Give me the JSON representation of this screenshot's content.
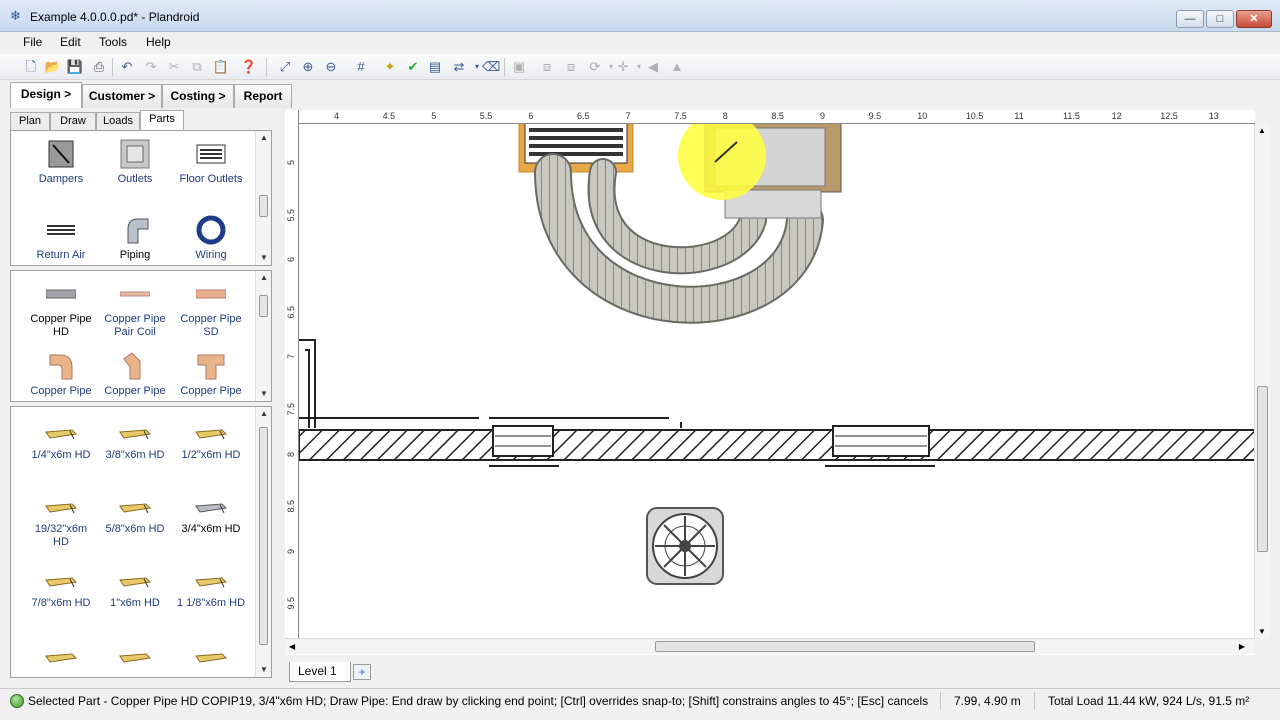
{
  "window": {
    "title": "Example 4.0.0.0.pd* - Plandroid",
    "min": "—",
    "max": "□",
    "close": "✕"
  },
  "menu": [
    "File",
    "Edit",
    "Tools",
    "Help"
  ],
  "nav_tabs": [
    "Design >",
    "Customer >",
    "Costing >",
    "Report"
  ],
  "sub_tabs": [
    "Plan",
    "Draw",
    "Loads",
    "Parts"
  ],
  "categories": [
    {
      "label": "Dampers"
    },
    {
      "label": "Outlets"
    },
    {
      "label": "Floor Outlets"
    },
    {
      "label": "Return Air"
    },
    {
      "label": "Piping"
    },
    {
      "label": "Wiring"
    }
  ],
  "pipe_types": [
    {
      "label": "Copper Pipe\nHD"
    },
    {
      "label": "Copper Pipe\nPair Coil"
    },
    {
      "label": "Copper Pipe\nSD"
    },
    {
      "label": "Copper Pipe"
    },
    {
      "label": "Copper Pipe"
    },
    {
      "label": "Copper Pipe"
    }
  ],
  "pipe_sizes": [
    {
      "label": "1/4\"x6m HD"
    },
    {
      "label": "3/8\"x6m HD"
    },
    {
      "label": "1/2\"x6m HD"
    },
    {
      "label": "19/32\"x6m\nHD"
    },
    {
      "label": "5/8\"x6m HD"
    },
    {
      "label": "3/4\"x6m HD"
    },
    {
      "label": "7/8\"x6m HD"
    },
    {
      "label": "1\"x6m HD"
    },
    {
      "label": "1 1/8\"x6m HD"
    }
  ],
  "ruler": {
    "unit": "m",
    "h_ticks": [
      "4",
      "4.5",
      "5",
      "5.5",
      "6",
      "6.5",
      "7",
      "7.5",
      "8",
      "8.5",
      "9",
      "9.5",
      "10",
      "10.5",
      "11",
      "11.5",
      "12",
      "12.5",
      "13"
    ],
    "v_ticks": [
      "5",
      "5.5",
      "6",
      "6.5",
      "7",
      "7.5",
      "8",
      "8.5",
      "9",
      "9.5"
    ]
  },
  "level_tab": "Level 1",
  "level_add": "+",
  "status": {
    "message": "Selected Part - Copper Pipe HD COPIP19, 3/4\"x6m HD; Draw Pipe: End draw by clicking end point; [Ctrl] overrides snap-to; [Shift] constrains angles to 45°; [Esc] cancels",
    "coords": "7.99, 4.90 m",
    "load": "Total Load 11.44 kW, 924 L/s, 91.5 m²"
  }
}
